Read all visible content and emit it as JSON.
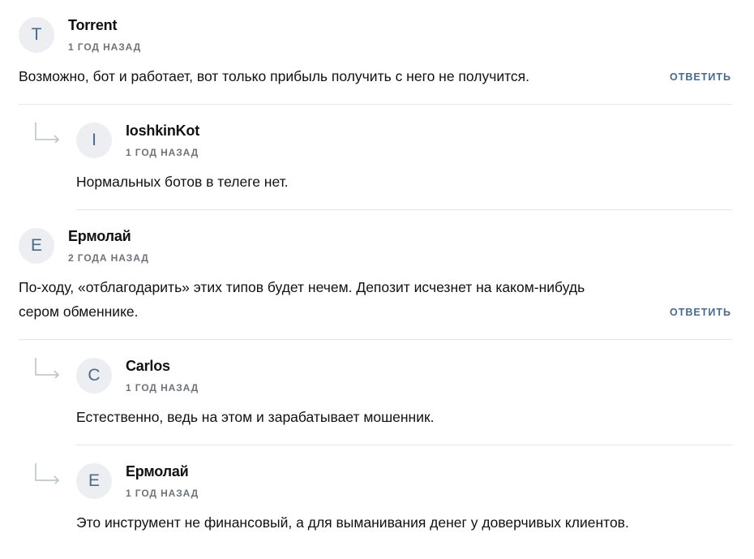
{
  "reply_label": "ОТВЕТИТЬ",
  "colors": {
    "avatar_bg": "#eceef1",
    "avatar_text": "#4b6a8a",
    "reply_link": "#476a8c",
    "date_text": "#6e7378",
    "divider": "#e4e6e9"
  },
  "comments": [
    {
      "initial": "T",
      "author": "Torrent",
      "date": "1 ГОД НАЗАД",
      "text_lines": [
        "Возможно, бот и работает, вот только прибыль получить с него не получится."
      ]
    },
    {
      "initial": "I",
      "author": "IoshkinKot",
      "date": "1 ГОД НАЗАД",
      "text_lines": [
        "Нормальных ботов в телеге нет."
      ]
    },
    {
      "initial": "E",
      "author": "Ермолай",
      "date": "2 ГОДА НАЗАД",
      "text_lines": [
        "По-ходу, «отблагодарить» этих типов будет нечем. Депозит исчезнет на каком-нибудь",
        "сером обменнике."
      ]
    },
    {
      "initial": "C",
      "author": "Carlos",
      "date": "1 ГОД НАЗАД",
      "text_lines": [
        "Естественно, ведь на этом и зарабатывает мошенник."
      ]
    },
    {
      "initial": "E",
      "author": "Ермолай",
      "date": "1 ГОД НАЗАД",
      "text_lines": [
        "Это инструмент не финансовый, а для выманивания денег у доверчивых клиентов."
      ]
    }
  ]
}
